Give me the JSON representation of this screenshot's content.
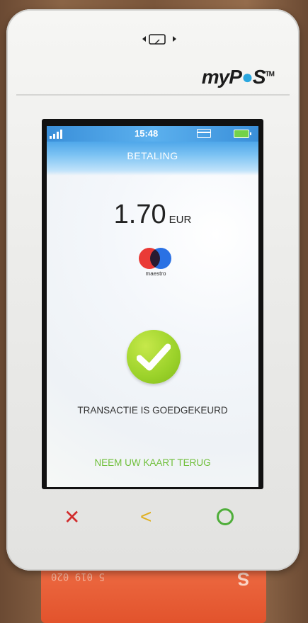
{
  "device": {
    "brand_prefix": "my",
    "brand_p": "P",
    "brand_s": "S",
    "brand_tm": "TM"
  },
  "statusbar": {
    "time": "15:48",
    "icons": [
      "signal-icon",
      "card-icon",
      "battery-icon"
    ]
  },
  "screen": {
    "title": "BETALING",
    "amount": "1.70",
    "currency": "EUR",
    "card_scheme": "maestro",
    "status_message": "TRANSACTIE IS GOEDGEKEURD",
    "hint": "NEEM UW KAART TERUG"
  },
  "keys": {
    "cancel_glyph": "✕",
    "back_glyph": "<"
  },
  "colors": {
    "accent_blue": "#3a8fd9",
    "success_green": "#9bd22a",
    "hint_green": "#6fbf3a",
    "cancel_red": "#d12c2c",
    "back_yellow": "#e0b020"
  }
}
